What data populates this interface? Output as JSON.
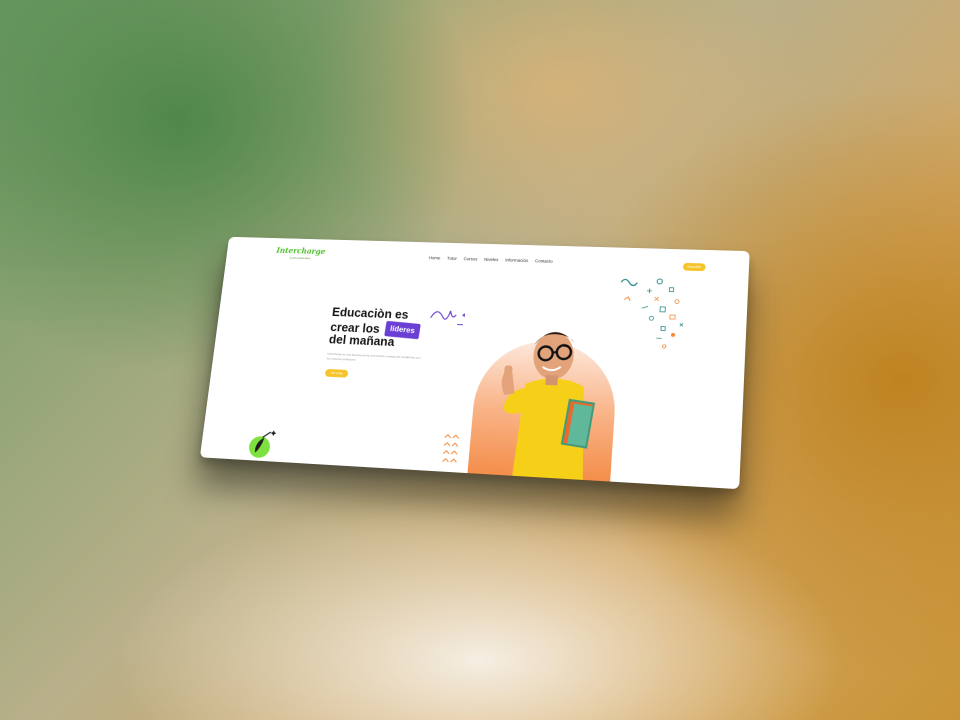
{
  "brand": {
    "name": "Intercharge",
    "tagline": "Centro Educativo",
    "accent": "#f6c42a",
    "logo_color": "#4fbf2c",
    "highlight": "#6b3fd4"
  },
  "nav": {
    "items": [
      "Home",
      "Tutor",
      "Cursos",
      "Niveles",
      "Información",
      "Contacto"
    ],
    "cta": "Inscribir"
  },
  "hero": {
    "title_line1": "Educaciòn es",
    "title_line2": "crear los",
    "highlight": "líderes",
    "title_line3": "del mañana",
    "description": "Intercharge es una fuente para la crecimiento y desarrollo académico con los mejores profesores",
    "button": "Ver más"
  }
}
